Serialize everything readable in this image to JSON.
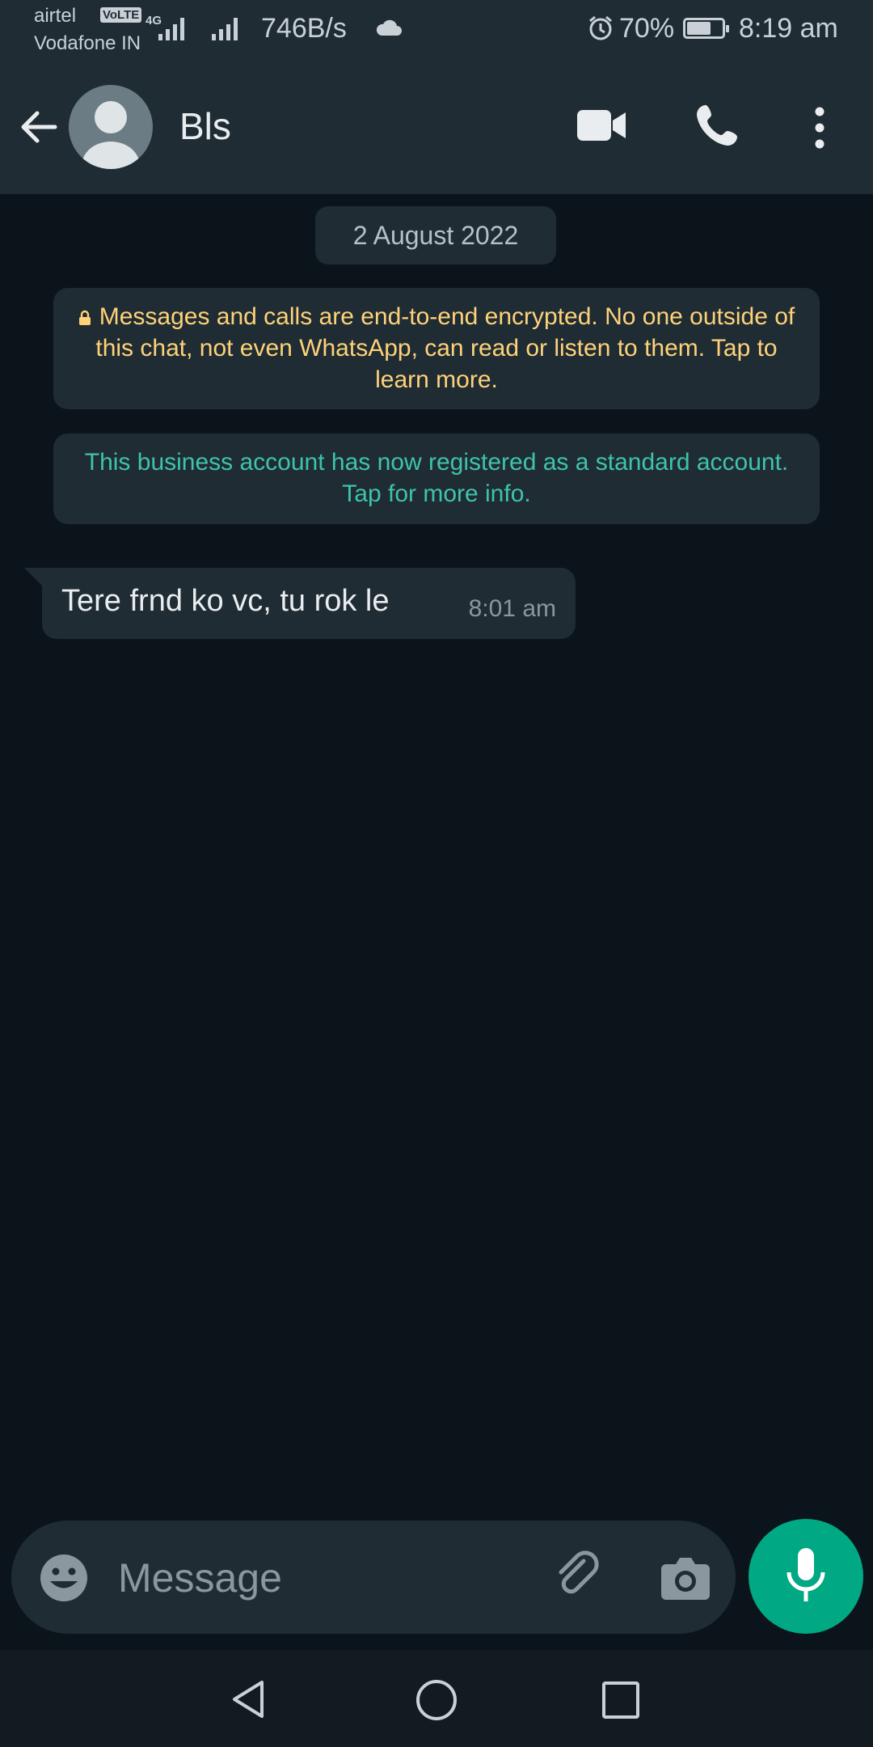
{
  "status_bar": {
    "carrier_primary": "airtel",
    "volte_badge": "VoLTE",
    "carrier_secondary": "Vodafone IN",
    "network_type": "4G",
    "network_speed": "746B/s",
    "battery_percent": "70%",
    "battery_level": 0.7,
    "time": "8:19 am",
    "icons": [
      "location-icon",
      "signal-icon",
      "cloud-icon",
      "alarm-icon",
      "battery-icon"
    ]
  },
  "header": {
    "contact_name": "Bls",
    "icons": [
      "back-arrow-icon",
      "avatar-icon",
      "video-call-icon",
      "voice-call-icon",
      "more-options-icon"
    ]
  },
  "chat": {
    "date_chip": "2 August 2022",
    "encryption_notice": "Messages and calls are end-to-end encrypted. No one outside of this chat, not even WhatsApp, can read or listen to them. Tap to learn more.",
    "business_notice": "This business account has now registered as a standard account. Tap for more info.",
    "messages": [
      {
        "direction": "incoming",
        "text": "Tere frnd ko vc, tu rok le",
        "time": "8:01 am"
      }
    ]
  },
  "input_bar": {
    "placeholder": "Message",
    "value": "",
    "icons": [
      "emoji-icon",
      "attach-icon",
      "camera-icon",
      "mic-icon"
    ]
  },
  "nav_bar": {
    "icons": [
      "nav-back-icon",
      "nav-home-icon",
      "nav-recents-icon"
    ]
  },
  "colors": {
    "bar_background": "#1f2c34",
    "chat_background": "#0b141a",
    "accent_green": "#00a884",
    "encryption_text": "#ffd279",
    "business_text": "#3fc3ab"
  }
}
